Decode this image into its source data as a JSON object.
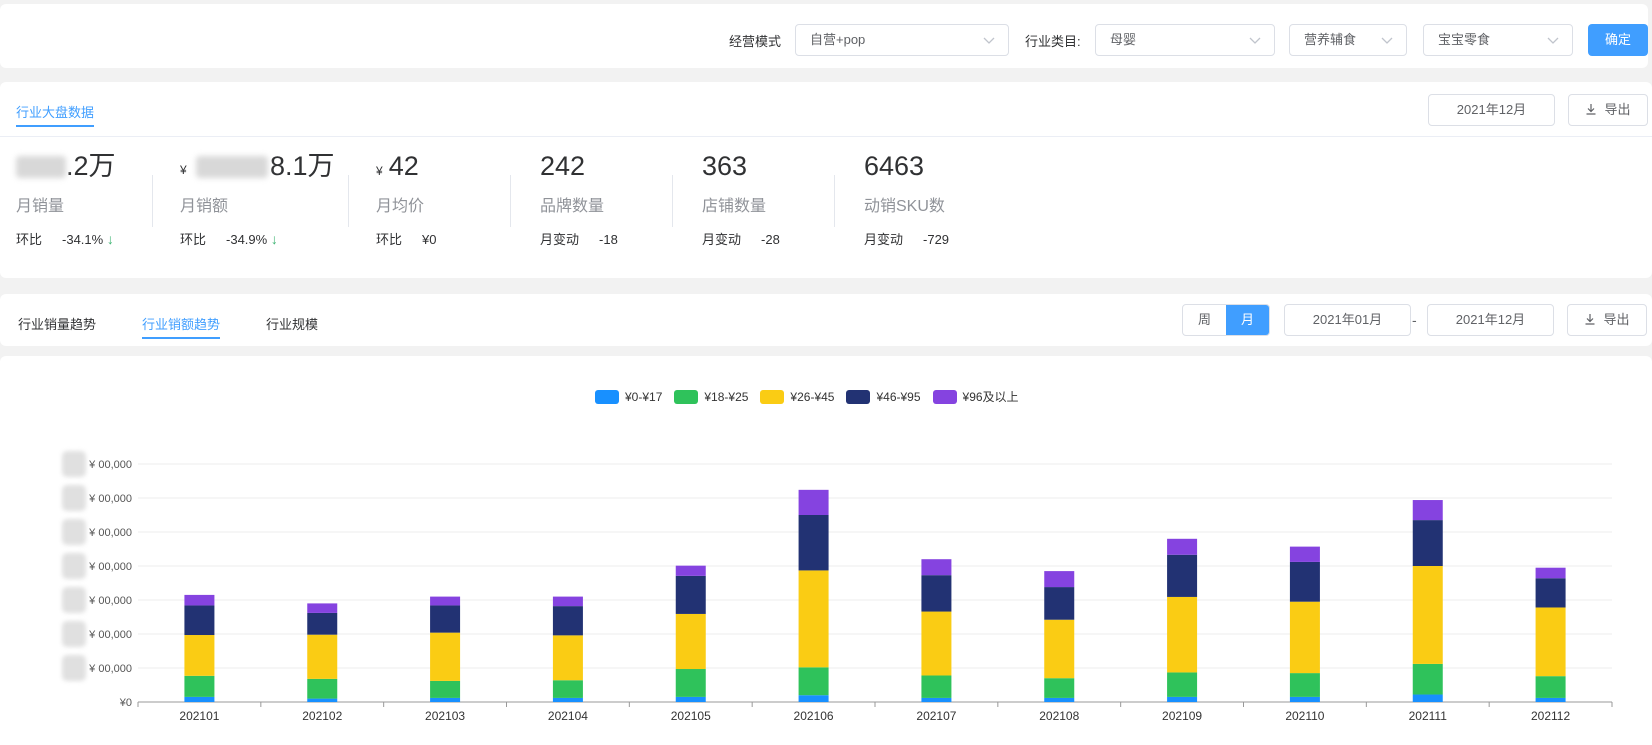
{
  "filters": {
    "mode_label": "经营模式",
    "mode_value": "自营+pop",
    "category_label": "行业类目:",
    "category_value": "母婴",
    "sub_category_value": "营养辅食",
    "sub_sub_category_value": "宝宝零食",
    "confirm_label": "确定"
  },
  "overview": {
    "tab_label": "行业大盘数据",
    "month_picker": "2021年12月",
    "export_label": "导出",
    "metrics": [
      {
        "value": ".2万",
        "currency": "",
        "label": "月销量",
        "change_key": "环比",
        "change_value": "-34.1%",
        "trend_icon": "arrow-down-icon"
      },
      {
        "value": "8.1万",
        "currency": "¥",
        "label": "月销额",
        "change_key": "环比",
        "change_value": "-34.9%",
        "trend_icon": "arrow-down-icon"
      },
      {
        "value": "42",
        "currency": "¥",
        "label": "月均价",
        "change_key": "环比",
        "change_value": "¥0"
      },
      {
        "value": "242",
        "currency": "",
        "label": "品牌数量",
        "change_key": "月变动",
        "change_value": "-18"
      },
      {
        "value": "363",
        "currency": "",
        "label": "店铺数量",
        "change_key": "月变动",
        "change_value": "-28"
      },
      {
        "value": "6463",
        "currency": "",
        "label": "动销SKU数",
        "change_key": "月变动",
        "change_value": "-729"
      }
    ]
  },
  "trend": {
    "tabs": [
      "行业销量趋势",
      "行业销额趋势",
      "行业规模"
    ],
    "active_tab": 1,
    "period_week": "周",
    "period_month": "月",
    "range_start": "2021年01月",
    "range_dash": "-",
    "range_end": "2021年12月",
    "export_label": "导出"
  },
  "colors": {
    "accent": "#409eff",
    "series": [
      "#1890ff",
      "#2fc25b",
      "#facc14",
      "#223273",
      "#8543e0"
    ]
  },
  "chart_data": {
    "type": "bar",
    "stacked": true,
    "categories": [
      "202101",
      "202102",
      "202103",
      "202104",
      "202105",
      "202106",
      "202107",
      "202108",
      "202109",
      "202110",
      "202111",
      "202112"
    ],
    "series": [
      {
        "name": "¥0-¥17",
        "values": [
          0.15,
          0.1,
          0.12,
          0.12,
          0.15,
          0.2,
          0.12,
          0.12,
          0.15,
          0.15,
          0.22,
          0.12
        ]
      },
      {
        "name": "¥18-¥25",
        "values": [
          0.62,
          0.58,
          0.5,
          0.52,
          0.82,
          0.82,
          0.66,
          0.58,
          0.72,
          0.7,
          0.9,
          0.64
        ]
      },
      {
        "name": "¥26-¥45",
        "values": [
          1.2,
          1.3,
          1.42,
          1.32,
          1.62,
          2.85,
          1.88,
          1.72,
          2.22,
          2.1,
          2.88,
          2.02
        ]
      },
      {
        "name": "¥46-¥95",
        "values": [
          0.87,
          0.64,
          0.8,
          0.86,
          1.12,
          1.63,
          1.07,
          0.96,
          1.24,
          1.17,
          1.35,
          0.86
        ]
      },
      {
        "name": "¥96及以上",
        "values": [
          0.31,
          0.28,
          0.26,
          0.28,
          0.3,
          0.74,
          0.47,
          0.47,
          0.47,
          0.45,
          0.59,
          0.31
        ]
      }
    ],
    "yaxis_ticks": [
      "¥0",
      "¥ 00,000",
      "¥ 00,000",
      "¥ 00,000",
      "¥ 00,000",
      "¥ 00,000",
      "¥ 00,000",
      "¥ 00,000"
    ],
    "ylim": [
      0,
      7
    ],
    "grid": true,
    "legend_position": "top-center"
  }
}
